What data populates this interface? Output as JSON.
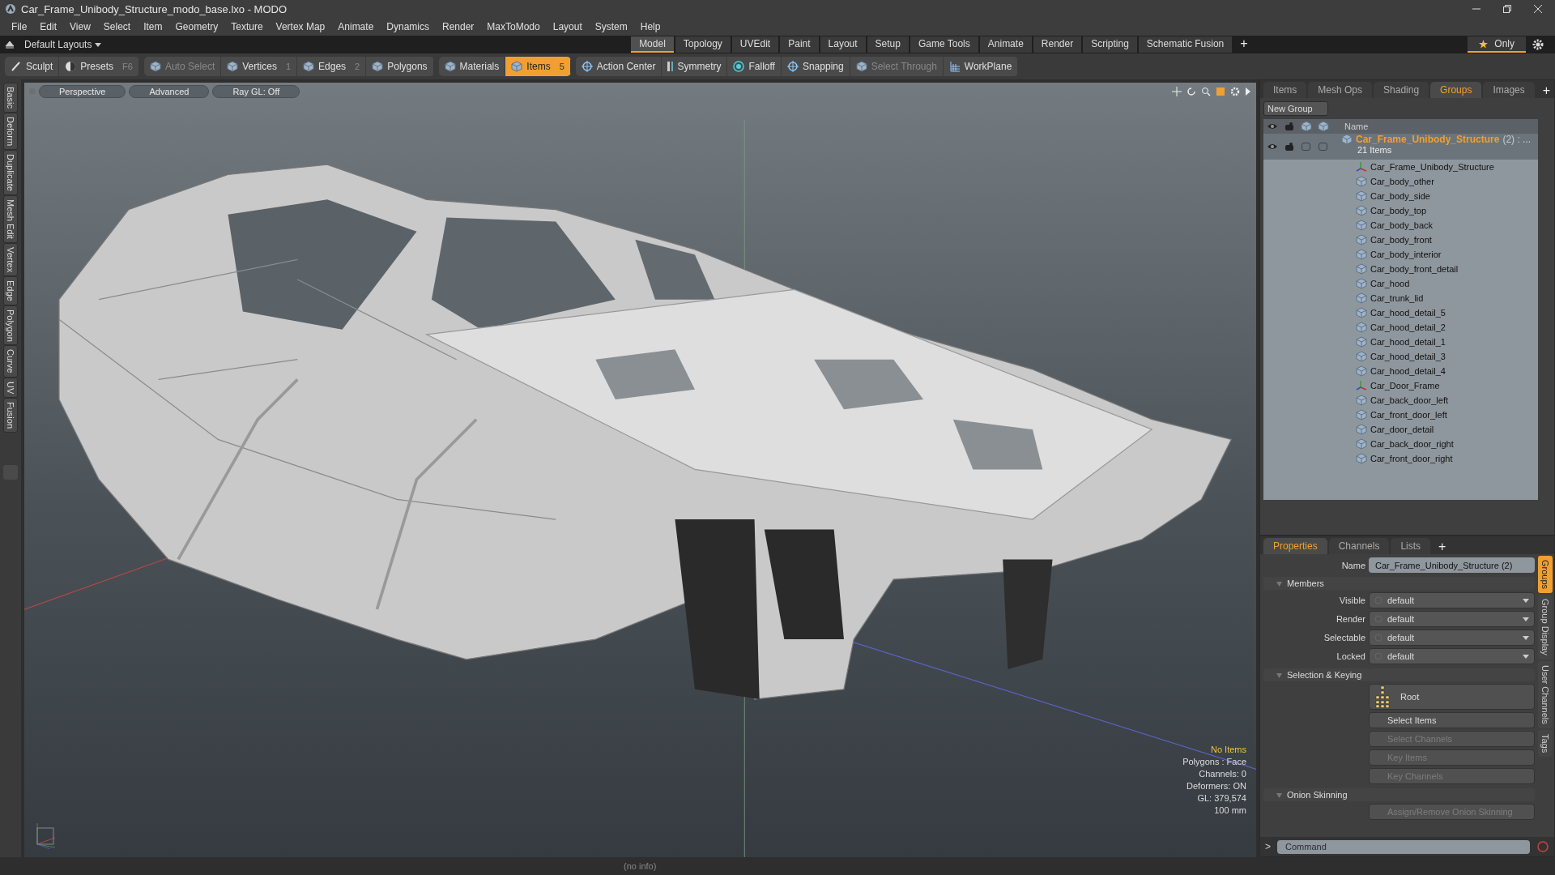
{
  "window": {
    "title": "Car_Frame_Unibody_Structure_modo_base.lxo - MODO"
  },
  "menu": [
    "File",
    "Edit",
    "View",
    "Select",
    "Item",
    "Geometry",
    "Texture",
    "Vertex Map",
    "Animate",
    "Dynamics",
    "Render",
    "MaxToModo",
    "Layout",
    "System",
    "Help"
  ],
  "layout_bar": {
    "layouts": "Default Layouts",
    "tabs": [
      {
        "label": "Model",
        "selected": true
      },
      {
        "label": "Topology",
        "selected": false
      },
      {
        "label": "UVEdit",
        "selected": false
      },
      {
        "label": "Paint",
        "selected": false
      },
      {
        "label": "Layout",
        "selected": false
      },
      {
        "label": "Setup",
        "selected": false
      },
      {
        "label": "Game Tools",
        "selected": false
      },
      {
        "label": "Animate",
        "selected": false
      },
      {
        "label": "Render",
        "selected": false
      },
      {
        "label": "Scripting",
        "selected": false
      },
      {
        "label": "Schematic Fusion",
        "selected": false
      }
    ],
    "add": "+",
    "only": "Only"
  },
  "toolbar": [
    {
      "label": "Sculpt",
      "disabled": false,
      "selected": false
    },
    {
      "label": "Presets",
      "shortcut": "F6",
      "disabled": false,
      "selected": false
    },
    {
      "label": "Auto Select",
      "disabled": true,
      "selected": false
    },
    {
      "label": "Vertices",
      "shortcut": "1",
      "disabled": false,
      "selected": false
    },
    {
      "label": "Edges",
      "shortcut": "2",
      "disabled": false,
      "selected": false
    },
    {
      "label": "Polygons",
      "disabled": false,
      "selected": false
    },
    {
      "label": "Materials",
      "disabled": false,
      "selected": false
    },
    {
      "label": "Items",
      "shortcut": "5",
      "disabled": false,
      "selected": true
    },
    {
      "label": "Action Center",
      "disabled": false,
      "selected": false
    },
    {
      "label": "Symmetry",
      "disabled": false,
      "selected": false
    },
    {
      "label": "Falloff",
      "disabled": false,
      "selected": false
    },
    {
      "label": "Snapping",
      "disabled": false,
      "selected": false
    },
    {
      "label": "Select Through",
      "disabled": true,
      "selected": false
    },
    {
      "label": "WorkPlane",
      "disabled": false,
      "selected": false
    }
  ],
  "side_tabs": [
    "Basic",
    "Deform",
    "Duplicate",
    "Mesh Edit",
    "Vertex",
    "Edge",
    "Polygon",
    "Curve",
    "UV",
    "Fusion"
  ],
  "viewport": {
    "buttons": [
      "Perspective",
      "Advanced",
      "Ray GL: Off"
    ],
    "info": [
      {
        "text": "No Items",
        "kind": "highlight"
      },
      {
        "text": "Polygons : Face",
        "kind": "plain"
      },
      {
        "text": "Channels: 0",
        "kind": "plain"
      },
      {
        "text": "Deformers: ON",
        "kind": "plain"
      },
      {
        "text": "GL: 379,574",
        "kind": "plain"
      },
      {
        "text": "100 mm",
        "kind": "plain"
      }
    ]
  },
  "groups_panel": {
    "tabs": [
      {
        "label": "Items",
        "selected": false
      },
      {
        "label": "Mesh Ops",
        "selected": false
      },
      {
        "label": "Shading",
        "selected": false
      },
      {
        "label": "Groups",
        "selected": true
      },
      {
        "label": "Images",
        "selected": false
      }
    ],
    "add": "+",
    "new_group": "New Group",
    "column": "Name",
    "group": {
      "name": "Car_Frame_Unibody_Structure",
      "suffix": "(2) : ...",
      "count": "21 Items",
      "children": [
        {
          "name": "Car_Frame_Unibody_Structure",
          "kind": "locator"
        },
        {
          "name": "Car_body_other",
          "kind": "mesh"
        },
        {
          "name": "Car_body_side",
          "kind": "mesh"
        },
        {
          "name": "Car_body_top",
          "kind": "mesh"
        },
        {
          "name": "Car_body_back",
          "kind": "mesh"
        },
        {
          "name": "Car_body_front",
          "kind": "mesh"
        },
        {
          "name": "Car_body_interior",
          "kind": "mesh"
        },
        {
          "name": "Car_body_front_detail",
          "kind": "mesh"
        },
        {
          "name": "Car_hood",
          "kind": "mesh"
        },
        {
          "name": "Car_trunk_lid",
          "kind": "mesh"
        },
        {
          "name": "Car_hood_detail_5",
          "kind": "mesh"
        },
        {
          "name": "Car_hood_detail_2",
          "kind": "mesh"
        },
        {
          "name": "Car_hood_detail_1",
          "kind": "mesh"
        },
        {
          "name": "Car_hood_detail_3",
          "kind": "mesh"
        },
        {
          "name": "Car_hood_detail_4",
          "kind": "mesh"
        },
        {
          "name": "Car_Door_Frame",
          "kind": "locator"
        },
        {
          "name": "Car_back_door_left",
          "kind": "mesh"
        },
        {
          "name": "Car_front_door_left",
          "kind": "mesh"
        },
        {
          "name": "Car_door_detail",
          "kind": "mesh"
        },
        {
          "name": "Car_back_door_right",
          "kind": "mesh"
        },
        {
          "name": "Car_front_door_right",
          "kind": "mesh"
        }
      ]
    }
  },
  "properties_panel": {
    "tabs": [
      {
        "label": "Properties",
        "selected": true
      },
      {
        "label": "Channels",
        "selected": false
      },
      {
        "label": "Lists",
        "selected": false
      }
    ],
    "add": "+",
    "name_label": "Name",
    "name_value": "Car_Frame_Unibody_Structure (2)",
    "sections": [
      {
        "title": "Members",
        "rows": [
          {
            "kind": "dropdown",
            "label": "Visible",
            "value": "default"
          },
          {
            "kind": "dropdown",
            "label": "Render",
            "value": "default"
          },
          {
            "kind": "dropdown",
            "label": "Selectable",
            "value": "default"
          },
          {
            "kind": "dropdown",
            "label": "Locked",
            "value": "default"
          }
        ]
      },
      {
        "title": "Selection & Keying",
        "rows": [
          {
            "kind": "root",
            "label": "Root"
          },
          {
            "kind": "button",
            "label": "Select Items",
            "disabled": false
          },
          {
            "kind": "button",
            "label": "Select Channels",
            "disabled": true
          },
          {
            "kind": "button",
            "label": "Key Items",
            "disabled": true
          },
          {
            "kind": "button",
            "label": "Key Channels",
            "disabled": true
          }
        ]
      },
      {
        "title": "Onion Skinning",
        "rows": [
          {
            "kind": "button",
            "label": "Assign/Remove Onion Skinning",
            "disabled": true
          }
        ]
      }
    ],
    "side_tabs": [
      {
        "label": "Groups",
        "selected": true
      },
      {
        "label": "Group Display",
        "selected": false
      },
      {
        "label": "User Channels",
        "selected": false
      },
      {
        "label": "Tags",
        "selected": false
      }
    ]
  },
  "command": {
    "prompt": ">",
    "placeholder": "Command"
  },
  "status_bar": "(no info)"
}
